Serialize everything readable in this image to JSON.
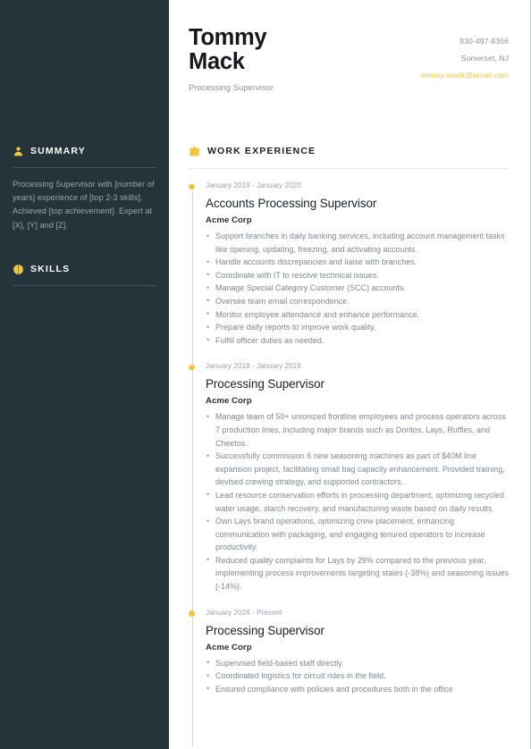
{
  "header": {
    "name": "Tommy Mack",
    "job_title": "Processing Supervisor",
    "contact": {
      "phone": "930-497-8356",
      "location": "Somerset, NJ",
      "email": "tommy.mack@email.com"
    }
  },
  "sidebar": {
    "summary": {
      "icon": "user-icon",
      "label": "SUMMARY",
      "text": "Processing Supervisor with [number of years] experience of [top 2-3 skills]. Achieved [top achievement]. Expert at [X], [Y] and [Z]."
    },
    "skills": {
      "icon": "medal-icon",
      "label": "SKILLS",
      "items": []
    }
  },
  "main": {
    "work_experience": {
      "icon": "briefcase-icon",
      "label": "WORK EXPERIENCE",
      "entries": [
        {
          "date": "January 2019 - January 2020",
          "role": "Accounts Processing Supervisor",
          "company": "Acme Corp",
          "bullets": [
            "Support branches in daily banking services, including account management tasks like opening, updating, freezing, and activating accounts.",
            "Handle accounts discrepancies and liaise with branches.",
            "Coordinate with IT to resolve technical issues.",
            "Manage Special Category Customer (SCC) accounts.",
            "Oversee team email correspondence.",
            "Monitor employee attendance and enhance performance.",
            "Prepare daily reports to improve work quality.",
            "Fulfill officer duties as needed."
          ]
        },
        {
          "date": "January 2018 - January 2019",
          "role": "Processing Supervisor",
          "company": "Acme Corp",
          "bullets": [
            "Manage team of 50+ unionized frontline employees and process operators across 7 production lines, including major brands such as Doritos, Lays, Ruffles, and Cheetos.",
            "Successfully commission 6 new seasoning machines as part of $40M line expansion project, facilitating small bag capacity enhancement. Provided training, devised crewing strategy, and supported contractors.",
            "Lead resource conservation efforts in processing department, optimizing recycled water usage, starch recovery, and manufacturing waste based on daily results.",
            "Own Lays brand operations, optimizing crew placement, enhancing communication with packaging, and engaging tenured operators to increase productivity.",
            "Reduced quality complaints for Lays by 29% compared to the previous year, implementing process improvements targeting stales (-38%) and seasoning issues (-14%)."
          ]
        },
        {
          "date": "January 2024 - Present",
          "role": "Processing Supervisor",
          "company": "Acme Corp",
          "bullets": [
            "Supervised field-based staff directly.",
            "Coordinated logistics for circuit rides in the field.",
            "Ensured compliance with policies and procedures both in the office"
          ]
        }
      ]
    }
  },
  "colors": {
    "sidebar_bg": "#25333b",
    "accent": "#f2c53d",
    "timeline_line": "#f5d97a",
    "body_text": "#7f868c",
    "heading_text": "#1c1f21"
  }
}
